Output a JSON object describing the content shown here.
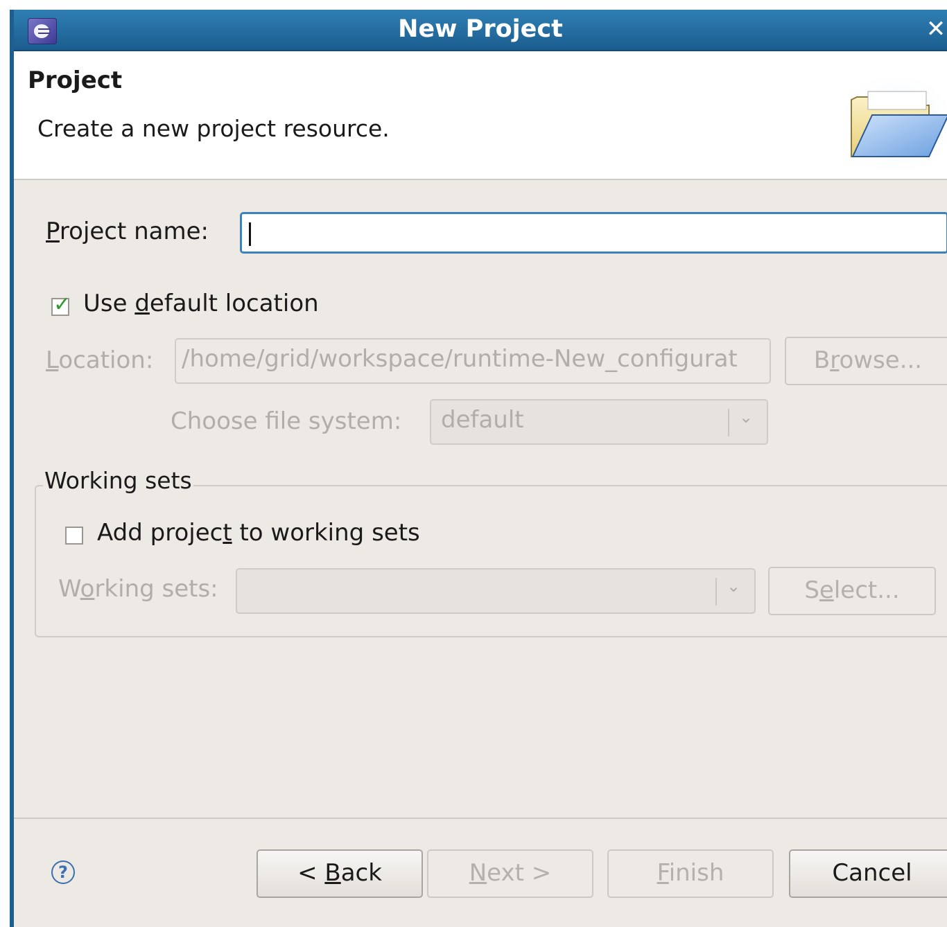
{
  "window": {
    "title": "New Project",
    "close_symbol": "✕"
  },
  "header": {
    "title": "Project",
    "description": "Create a new project resource."
  },
  "form": {
    "project_name_label": {
      "pre": "",
      "accel": "P",
      "post": "roject name:"
    },
    "project_name_value": "",
    "use_default_label": {
      "pre": "Use ",
      "accel": "d",
      "post": "efault location"
    },
    "use_default_checked": true,
    "location_label": {
      "pre": "",
      "accel": "L",
      "post": "ocation:"
    },
    "location_value": "/home/grid/workspace/runtime-New_configurat",
    "browse_label": {
      "pre": "B",
      "accel": "r",
      "post": "owse..."
    },
    "file_system_label": "Choose file system:",
    "file_system_value": "default"
  },
  "working_sets": {
    "group_title": "Working sets",
    "add_label": {
      "pre": "Add projec",
      "accel": "t",
      "post": " to working sets"
    },
    "add_checked": false,
    "sets_label": {
      "pre": "W",
      "accel": "o",
      "post": "rking sets:"
    },
    "sets_value": "",
    "select_label": {
      "pre": "S",
      "accel": "e",
      "post": "lect..."
    }
  },
  "footer": {
    "help_symbol": "?",
    "back_label": {
      "pre": "< ",
      "accel": "B",
      "post": "ack"
    },
    "next_label": {
      "pre": "",
      "accel": "N",
      "post": "ext >"
    },
    "finish_label": {
      "pre": "",
      "accel": "F",
      "post": "inish"
    },
    "cancel_label": "Cancel"
  },
  "icons": {
    "app": "eclipse-icon",
    "banner": "folder-open-icon",
    "combo_arrow": "chevron-down-icon",
    "help": "help-icon"
  }
}
